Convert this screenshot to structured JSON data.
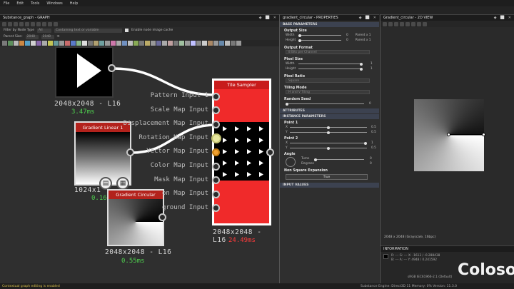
{
  "menu": [
    "File",
    "Edit",
    "Tools",
    "Windows",
    "Help"
  ],
  "graph_panel": {
    "title": "Substance_graph - GRAPH",
    "filter_label": "Filter by Node Type",
    "filter_value": "All",
    "search_placeholder": "Containing text or variable",
    "cache_label": "Enable node image cache",
    "parent_size_label": "Parent Size:",
    "parent_size_w": "2048",
    "parent_size_h": "2048"
  },
  "nodes": {
    "top": {
      "label": "2048x2048 - L16",
      "time": "3.47ms"
    },
    "gradient_linear": {
      "title": "Gradient Linear 1",
      "label": "1024x1",
      "time": "0.16"
    },
    "gradient_circular": {
      "title": "Gradient Circular",
      "label": "2048x2048 - L16",
      "time": "0.55ms"
    },
    "tile_sampler": {
      "title": "Tile Sampler",
      "label": "2048x2048 - L16",
      "time": "24.49ms",
      "inputs": [
        "Pattern Input 1",
        "Scale Map Input",
        "Displacement Map Input",
        "Rotation Map Input",
        "Vector Map Input",
        "Color Map Input",
        "Mask Map Input",
        "on Map Input",
        "ground Input"
      ]
    }
  },
  "properties": {
    "title": "gradient_circular - PROPERTIES",
    "base_parameters": "BASE PARAMETERS",
    "output_size": "Output Size",
    "width_label": "Width",
    "height_label": "Height",
    "width_value": "0",
    "height_value": "0",
    "parent_w": "Parent x 1",
    "parent_h": "Parent x 1",
    "output_format": "Output Format",
    "output_format_value": "8 Bits per Channel",
    "pixel_size": "Pixel Size",
    "pixel_w": "1",
    "pixel_h": "1",
    "pixel_ratio": "Pixel Ratio",
    "pixel_ratio_value": "Square",
    "tiling_mode": "Tiling Mode",
    "tiling_mode_value": "H and V Tiling",
    "random_seed": "Random Seed",
    "random_seed_value": "0",
    "attributes": "ATTRIBUTES",
    "instance_parameters": "INSTANCE PARAMETERS",
    "point1": "Point 1",
    "point1_x": "0.5",
    "point1_y": "0.5",
    "point2": "Point 2",
    "point2_x": "1",
    "point2_y": "0.5",
    "angle": "Angle",
    "turns": "Turns",
    "degrees": "Degrees",
    "turns_value": "0",
    "degrees_value": "0",
    "nonsquare": "Non Square Expansion",
    "nonsquare_value": "True",
    "input_values": "INPUT VALUES"
  },
  "view2d": {
    "title": "Gradient_circular - 2D VIEW",
    "caption": "2048 x 2048 (Grayscale, 16bpc)"
  },
  "info": {
    "title": "INFORMATION",
    "row1": "R: ---   G: ---   X: -1613 / -0.288438",
    "row2": "B: ---   A: ---   Y: 4948 / 0.241592",
    "footer": "sRGB IEC61966-2.1 (Default)"
  },
  "status": {
    "left": "Contextual graph editing is enabled",
    "right": "Substance Engine: Direct3D 11  Memory: 0%    Version: 11.3.0"
  },
  "watermark": "Coloso"
}
